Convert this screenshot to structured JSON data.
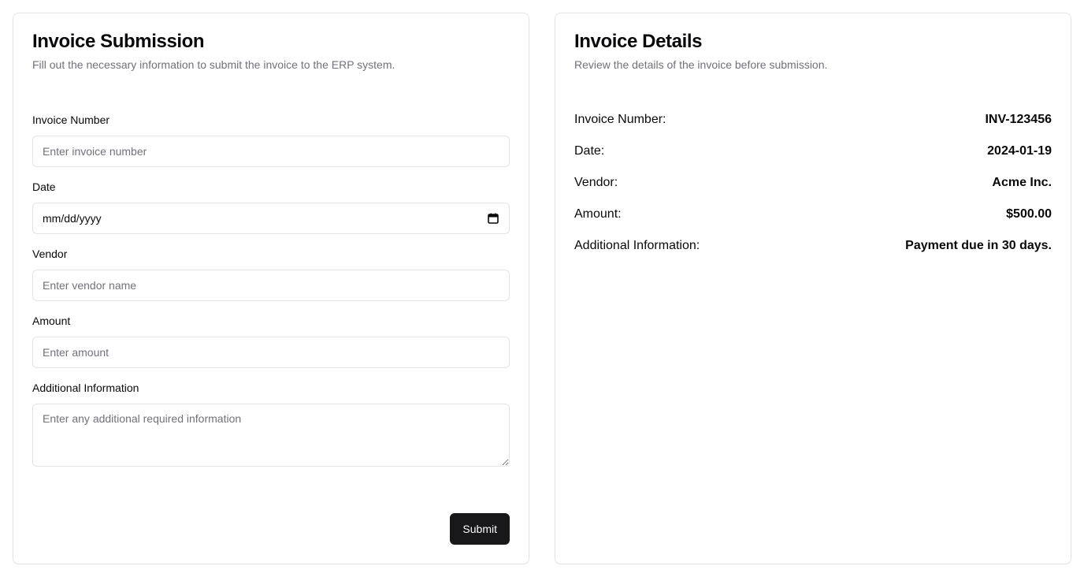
{
  "submission": {
    "title": "Invoice Submission",
    "description": "Fill out the necessary information to submit the invoice to the ERP system.",
    "fields": {
      "invoice_number": {
        "label": "Invoice Number",
        "placeholder": "Enter invoice number",
        "value": ""
      },
      "date": {
        "label": "Date",
        "display": "mm/dd/yyyy",
        "icon": "calendar-icon"
      },
      "vendor": {
        "label": "Vendor",
        "placeholder": "Enter vendor name",
        "value": ""
      },
      "amount": {
        "label": "Amount",
        "placeholder": "Enter amount",
        "value": ""
      },
      "additional_info": {
        "label": "Additional Information",
        "placeholder": "Enter any additional required information",
        "value": ""
      }
    },
    "submit_label": "Submit"
  },
  "details": {
    "title": "Invoice Details",
    "description": "Review the details of the invoice before submission.",
    "rows": [
      {
        "label": "Invoice Number:",
        "value": "INV-123456"
      },
      {
        "label": "Date:",
        "value": "2024-01-19"
      },
      {
        "label": "Vendor:",
        "value": "Acme Inc."
      },
      {
        "label": "Amount:",
        "value": "$500.00"
      },
      {
        "label": "Additional Information:",
        "value": "Payment due in 30 days."
      }
    ]
  },
  "colors": {
    "border": "#e4e4e7",
    "muted_text": "#71717a",
    "primary_button": "#18181b",
    "primary_button_text": "#fafafa"
  }
}
